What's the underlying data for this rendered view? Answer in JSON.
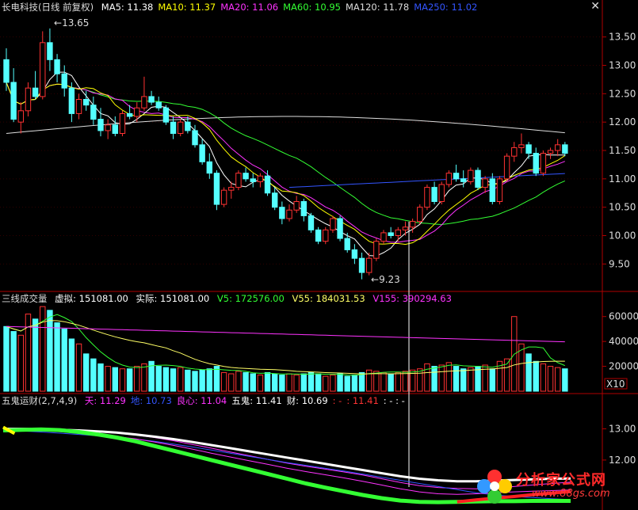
{
  "app": {
    "close_glyph": "✕"
  },
  "price_panel": {
    "title": "长电科技(日线 前复权)",
    "ma": [
      {
        "label": "MA5: 11.38",
        "color": "#ffffff"
      },
      {
        "label": "MA10: 11.37",
        "color": "#ffff00"
      },
      {
        "label": "MA20: 11.06",
        "color": "#ff33ff"
      },
      {
        "label": "MA60: 10.95",
        "color": "#33ff33"
      },
      {
        "label": "MA120: 11.78",
        "color": "#dddddd"
      },
      {
        "label": "MA250: 11.02",
        "color": "#3355ff"
      }
    ],
    "high_label": "13.65",
    "low_label": "9.23",
    "y_ticks": [
      "13.50",
      "13.00",
      "12.50",
      "12.00",
      "11.50",
      "11.00",
      "10.50",
      "10.00",
      "9.50"
    ],
    "y_min": 9.1,
    "y_max": 13.9
  },
  "volume_panel": {
    "title": "三线成交量",
    "virtual": "虚拟: 151081.00",
    "actual": "实际: 151081.00",
    "v5": "V5: 172576.00",
    "v55": "V55: 184031.53",
    "v155": "V155: 390294.63",
    "y_ticks": [
      "60000",
      "40000",
      "20000"
    ],
    "unit": "X10",
    "y_max": 70000
  },
  "indicator_panel": {
    "title": "五鬼运财(2,7,4,9)",
    "items": [
      {
        "label": "天: 11.29",
        "color": "#ff33ff"
      },
      {
        "label": "地: 10.73",
        "color": "#3355ff"
      },
      {
        "label": "良心: 11.04",
        "color": "#ff33ff"
      },
      {
        "label": "五鬼: 11.41",
        "color": "#ffffff"
      },
      {
        "label": "财: 10.69",
        "color": "#ffffff"
      },
      {
        "label": ": -",
        "color": "#ff3333"
      },
      {
        "label": ": 11.41",
        "color": "#ff3333"
      },
      {
        "label": ": - : -",
        "color": "#ffffff"
      }
    ],
    "y_ticks": [
      "13.00",
      "12.00"
    ],
    "y_min": 10.5,
    "y_max": 13.8
  },
  "watermark": {
    "line1": "分析家公式网",
    "line2": "www.88gs.com"
  },
  "colors": {
    "up": "#ff3232",
    "down": "#54ffff",
    "ma5": "#ffffff",
    "ma10": "#ffff00",
    "ma20": "#ff33ff",
    "ma60": "#33ff33",
    "ma120": "#dddddd",
    "ma250": "#3355ff",
    "grid": "#b00000"
  },
  "chart_data": [
    {
      "type": "candlestick",
      "title": "长电科技(日线 前复权)",
      "ylim": [
        9.1,
        13.9
      ],
      "candles": [
        [
          13.1,
          13.3,
          12.55,
          12.7
        ],
        [
          12.7,
          12.95,
          12.0,
          12.05
        ],
        [
          12.0,
          12.35,
          11.8,
          12.2
        ],
        [
          12.2,
          12.7,
          12.1,
          12.6
        ],
        [
          12.6,
          12.9,
          12.4,
          12.45
        ],
        [
          12.45,
          13.6,
          12.4,
          13.4
        ],
        [
          13.4,
          13.65,
          12.9,
          13.1
        ],
        [
          13.1,
          13.2,
          12.7,
          12.85
        ],
        [
          12.85,
          13.0,
          12.45,
          12.6
        ],
        [
          12.6,
          12.7,
          12.0,
          12.15
        ],
        [
          12.15,
          12.5,
          12.05,
          12.4
        ],
        [
          12.4,
          12.55,
          12.2,
          12.3
        ],
        [
          12.3,
          12.45,
          11.95,
          12.05
        ],
        [
          12.05,
          12.25,
          11.75,
          11.85
        ],
        [
          11.85,
          12.05,
          11.7,
          11.95
        ],
        [
          11.95,
          12.1,
          11.75,
          11.8
        ],
        [
          11.8,
          12.2,
          11.75,
          12.15
        ],
        [
          12.15,
          12.3,
          12.05,
          12.1
        ],
        [
          12.1,
          12.35,
          12.0,
          12.25
        ],
        [
          12.25,
          12.8,
          12.2,
          12.45
        ],
        [
          12.45,
          12.55,
          12.3,
          12.35
        ],
        [
          12.35,
          12.45,
          12.2,
          12.25
        ],
        [
          12.25,
          12.3,
          11.95,
          12.0
        ],
        [
          12.0,
          12.1,
          11.7,
          11.8
        ],
        [
          11.8,
          12.05,
          11.75,
          12.0
        ],
        [
          12.0,
          12.1,
          11.8,
          11.85
        ],
        [
          11.85,
          11.95,
          11.55,
          11.6
        ],
        [
          11.6,
          11.7,
          11.25,
          11.3
        ],
        [
          11.3,
          11.45,
          11.0,
          11.1
        ],
        [
          11.1,
          11.15,
          10.45,
          10.55
        ],
        [
          10.55,
          10.85,
          10.5,
          10.8
        ],
        [
          10.8,
          10.95,
          10.65,
          10.85
        ],
        [
          10.85,
          11.15,
          10.8,
          11.1
        ],
        [
          11.1,
          11.2,
          10.95,
          11.0
        ],
        [
          11.0,
          11.1,
          10.85,
          10.95
        ],
        [
          10.95,
          11.1,
          10.85,
          11.05
        ],
        [
          11.05,
          11.15,
          10.7,
          10.75
        ],
        [
          10.75,
          10.85,
          10.45,
          10.5
        ],
        [
          10.5,
          10.6,
          10.2,
          10.3
        ],
        [
          10.3,
          10.55,
          10.25,
          10.45
        ],
        [
          10.45,
          10.7,
          10.4,
          10.6
        ],
        [
          10.6,
          10.65,
          10.25,
          10.35
        ],
        [
          10.35,
          10.4,
          10.05,
          10.1
        ],
        [
          10.1,
          10.15,
          9.85,
          9.9
        ],
        [
          9.9,
          10.15,
          9.85,
          10.1
        ],
        [
          10.1,
          10.35,
          10.05,
          10.3
        ],
        [
          10.3,
          10.35,
          9.9,
          9.95
        ],
        [
          9.95,
          10.05,
          9.7,
          9.75
        ],
        [
          9.75,
          9.85,
          9.5,
          9.6
        ],
        [
          9.6,
          9.7,
          9.23,
          9.35
        ],
        [
          9.35,
          9.7,
          9.3,
          9.6
        ],
        [
          9.6,
          9.95,
          9.55,
          9.9
        ],
        [
          9.9,
          10.1,
          9.85,
          10.05
        ],
        [
          10.05,
          10.15,
          9.95,
          10.0
        ],
        [
          10.0,
          10.15,
          9.9,
          10.1
        ],
        [
          10.1,
          10.25,
          10.0,
          10.15
        ],
        [
          10.15,
          10.3,
          10.05,
          10.25
        ],
        [
          10.25,
          10.55,
          10.2,
          10.5
        ],
        [
          10.5,
          10.9,
          10.45,
          10.85
        ],
        [
          10.85,
          10.95,
          10.55,
          10.6
        ],
        [
          10.6,
          10.95,
          10.55,
          10.9
        ],
        [
          10.9,
          11.15,
          10.85,
          11.1
        ],
        [
          11.1,
          11.25,
          10.95,
          11.0
        ],
        [
          11.0,
          11.15,
          10.85,
          10.95
        ],
        [
          10.95,
          11.2,
          10.9,
          11.15
        ],
        [
          11.15,
          11.2,
          10.8,
          10.85
        ],
        [
          10.85,
          11.05,
          10.75,
          11.0
        ],
        [
          11.0,
          11.1,
          10.55,
          10.6
        ],
        [
          10.6,
          11.05,
          10.55,
          11.0
        ],
        [
          11.0,
          11.45,
          10.95,
          11.4
        ],
        [
          11.4,
          11.65,
          11.3,
          11.55
        ],
        [
          11.55,
          11.8,
          11.45,
          11.6
        ],
        [
          11.6,
          11.65,
          11.35,
          11.45
        ],
        [
          11.45,
          11.55,
          11.05,
          11.1
        ],
        [
          11.1,
          11.5,
          11.05,
          11.45
        ],
        [
          11.45,
          11.55,
          11.35,
          11.5
        ],
        [
          11.5,
          11.7,
          11.4,
          11.6
        ],
        [
          11.6,
          11.65,
          11.4,
          11.45
        ]
      ]
    },
    {
      "type": "bar",
      "title": "三线成交量",
      "ylim": [
        0,
        70000
      ],
      "values": [
        52000,
        48000,
        45000,
        62000,
        58000,
        68000,
        65000,
        55000,
        50000,
        42000,
        38000,
        30000,
        26000,
        22000,
        20000,
        19000,
        18000,
        18000,
        20000,
        22000,
        24000,
        20000,
        19000,
        18000,
        19000,
        17000,
        16000,
        17000,
        18000,
        20000,
        15000,
        14000,
        16000,
        15000,
        14000,
        13000,
        15000,
        14000,
        13000,
        14000,
        13000,
        14000,
        15000,
        14000,
        12000,
        13000,
        14000,
        12000,
        13000,
        15000,
        17000,
        16000,
        15000,
        14000,
        15000,
        16000,
        17000,
        18000,
        22000,
        20000,
        21000,
        23000,
        20000,
        18000,
        19000,
        20000,
        21000,
        18000,
        24000,
        26000,
        60000,
        38000,
        30000,
        24000,
        22000,
        20000,
        19000,
        18000
      ]
    },
    {
      "type": "line",
      "title": "五鬼运财(2,7,4,9)",
      "ylim": [
        10.5,
        13.8
      ],
      "series": [
        {
          "name": "天",
          "values": [
            13.0,
            12.99,
            12.98,
            12.96,
            12.93,
            12.9,
            12.86,
            12.8,
            12.72,
            12.62,
            12.5,
            12.38,
            12.26,
            12.14,
            12.02,
            11.9,
            11.8,
            11.71,
            11.62,
            11.52,
            11.4,
            11.28,
            11.18,
            11.12,
            11.09,
            11.08,
            11.1,
            11.15,
            11.2,
            11.25,
            11.29
          ]
        },
        {
          "name": "地",
          "values": [
            12.95,
            12.93,
            12.9,
            12.86,
            12.82,
            12.78,
            12.73,
            12.67,
            12.6,
            12.51,
            12.42,
            12.32,
            12.22,
            12.12,
            12.02,
            11.92,
            11.83,
            11.74,
            11.65,
            11.55,
            11.45,
            11.35,
            11.25,
            11.15,
            11.05,
            10.95,
            10.88,
            10.83,
            10.8,
            10.76,
            10.73
          ]
        },
        {
          "name": "良心",
          "values": [
            12.98,
            12.96,
            12.94,
            12.91,
            12.86,
            12.81,
            12.75,
            12.68,
            12.58,
            12.47,
            12.35,
            12.22,
            12.1,
            11.98,
            11.86,
            11.74,
            11.63,
            11.53,
            11.43,
            11.32,
            11.2,
            11.08,
            10.98,
            10.92,
            10.9,
            10.92,
            10.95,
            10.98,
            11.0,
            11.02,
            11.04
          ]
        },
        {
          "name": "五鬼",
          "values": [
            13.0,
            13.0,
            12.99,
            12.97,
            12.95,
            12.92,
            12.88,
            12.82,
            12.75,
            12.67,
            12.58,
            12.48,
            12.38,
            12.28,
            12.18,
            12.08,
            11.98,
            11.88,
            11.78,
            11.68,
            11.58,
            11.48,
            11.4,
            11.35,
            11.32,
            11.32,
            11.34,
            11.36,
            11.38,
            11.4,
            11.41
          ]
        },
        {
          "name": "财",
          "values": [
            12.95,
            12.97,
            12.98,
            12.96,
            12.9,
            12.82,
            12.72,
            12.6,
            12.45,
            12.3,
            12.15,
            12.0,
            11.85,
            11.7,
            11.55,
            11.4,
            11.25,
            11.12,
            11.0,
            10.88,
            10.78,
            10.7,
            10.66,
            10.65,
            10.66,
            10.67,
            10.68,
            10.68,
            10.69,
            10.69,
            10.69
          ]
        }
      ]
    }
  ]
}
